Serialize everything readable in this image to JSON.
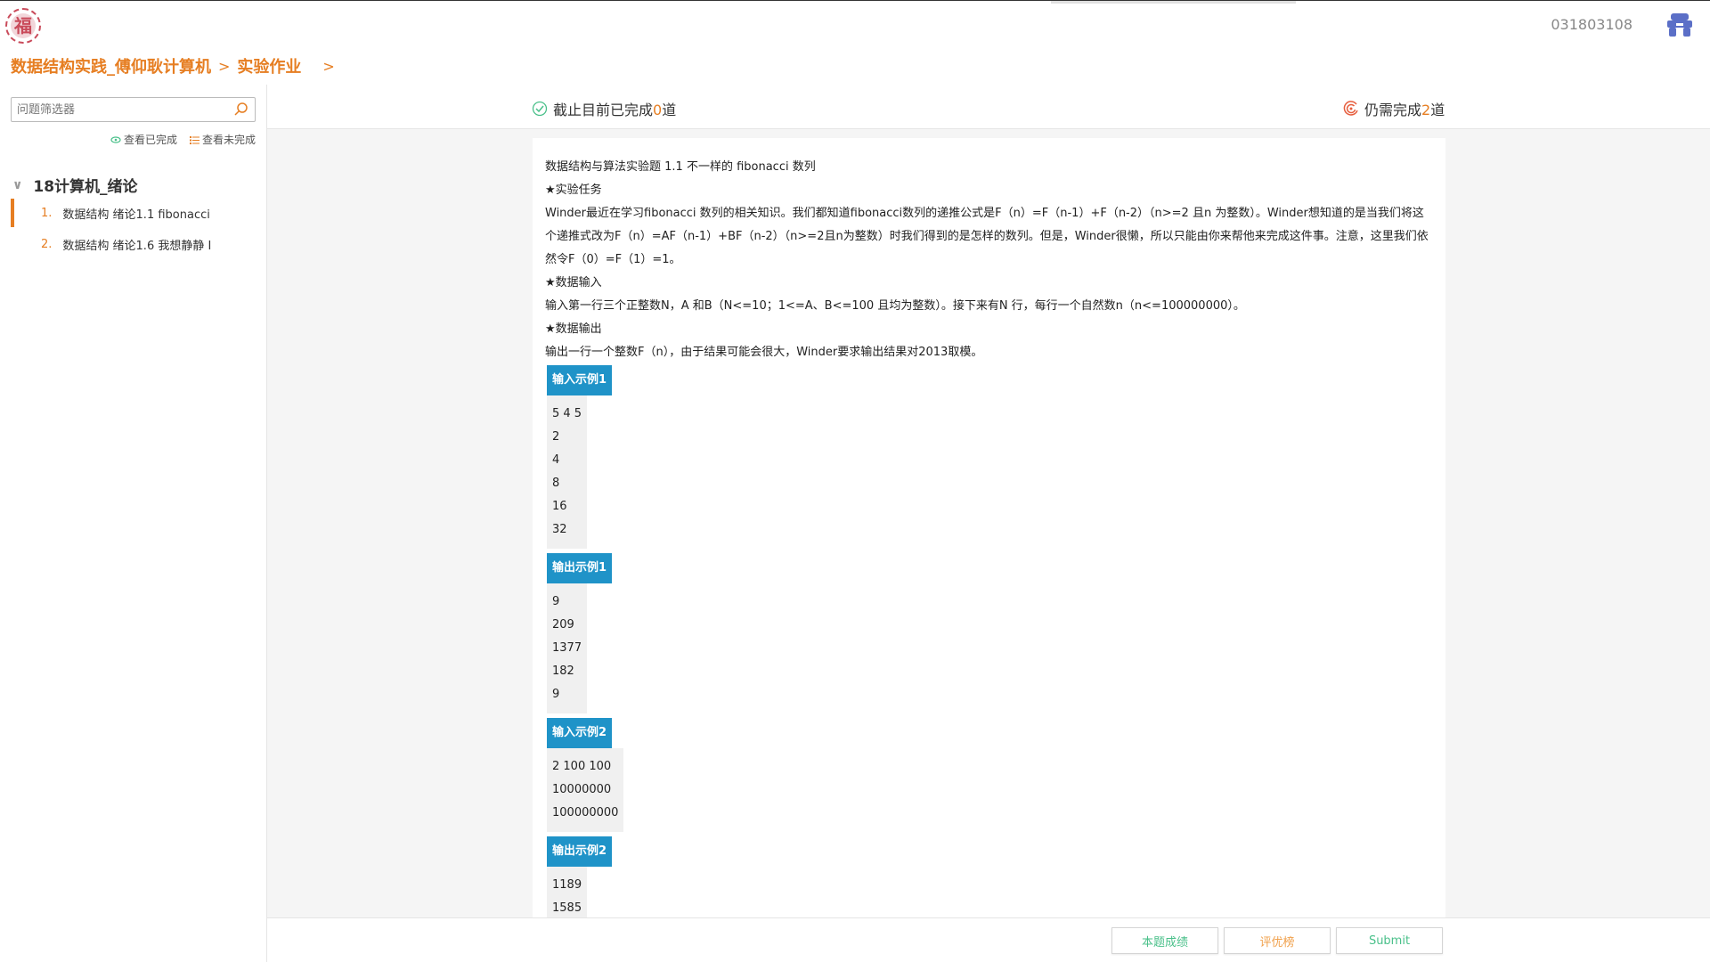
{
  "header": {
    "user_id": "031803108",
    "breadcrumb": {
      "course": "数据结构实践_傅仰耿计算机",
      "section": "实验作业"
    },
    "logo_char": "福"
  },
  "sidebar": {
    "filter_placeholder": "问题筛选器",
    "view_done": "查看已完成",
    "view_undone": "查看未完成",
    "group_title": "18计算机_绪论",
    "items": [
      {
        "num": "1.",
        "label": "数据结构 绪论1.1 fibonacci"
      },
      {
        "num": "2.",
        "label": "数据结构 绪论1.6 我想静静 I"
      }
    ]
  },
  "stats": {
    "done_prefix": "截止目前已完成",
    "done_count": "0",
    "done_suffix": "道",
    "remain_prefix": "仍需完成",
    "remain_count": "2",
    "remain_suffix": "道"
  },
  "problem": {
    "title": "数据结构与算法实验题 1.1 不一样的 fibonacci 数列",
    "task_heading": "★实验任务",
    "task_text_1": "Winder最近在学习fibonacci 数列的相关知识。我们都知道fibonacci数列的递推公式是F（n）=F（n-1）+F（n-2）（n>=2 且n 为整数）。Winder想知道的是当我们将这",
    "task_text_2": "个递推式改为F（n）=AF（n-1）+BF（n-2）（n>=2且n为整数）时我们得到的是怎样的数列。但是，Winder很懒，所以只能由你来帮他来完成这件事。注意，这里我们依",
    "task_text_3": "然令F（0）=F（1）=1。",
    "input_heading": "★数据输入",
    "input_text": "输入第一行三个正整数N，A 和B（N<=10；1<=A、B<=100 且均为整数）。接下来有N 行，每行一个自然数n（n<=100000000）。",
    "output_heading": "★数据输出",
    "output_text": "输出一行一个整数F（n），由于结果可能会很大，Winder要求输出结果对2013取模。",
    "samples": [
      {
        "label": "输入示例1",
        "lines": [
          "5 4 5",
          "2",
          "4",
          "8",
          "16",
          "32"
        ]
      },
      {
        "label": "输出示例1",
        "lines": [
          "9",
          "209",
          "1377",
          "182",
          "9"
        ]
      },
      {
        "label": "输入示例2",
        "lines": [
          "2 100 100",
          "10000000",
          "100000000"
        ]
      },
      {
        "label": "输出示例2",
        "lines": [
          "1189",
          "1585"
        ]
      }
    ]
  },
  "footer": {
    "score_btn": "本题成绩",
    "rank_btn": "评优榜",
    "submit_btn": "Submit"
  },
  "colors": {
    "accent": "#e67e22",
    "tag": "#1f93c8",
    "green": "#4ac08a"
  }
}
